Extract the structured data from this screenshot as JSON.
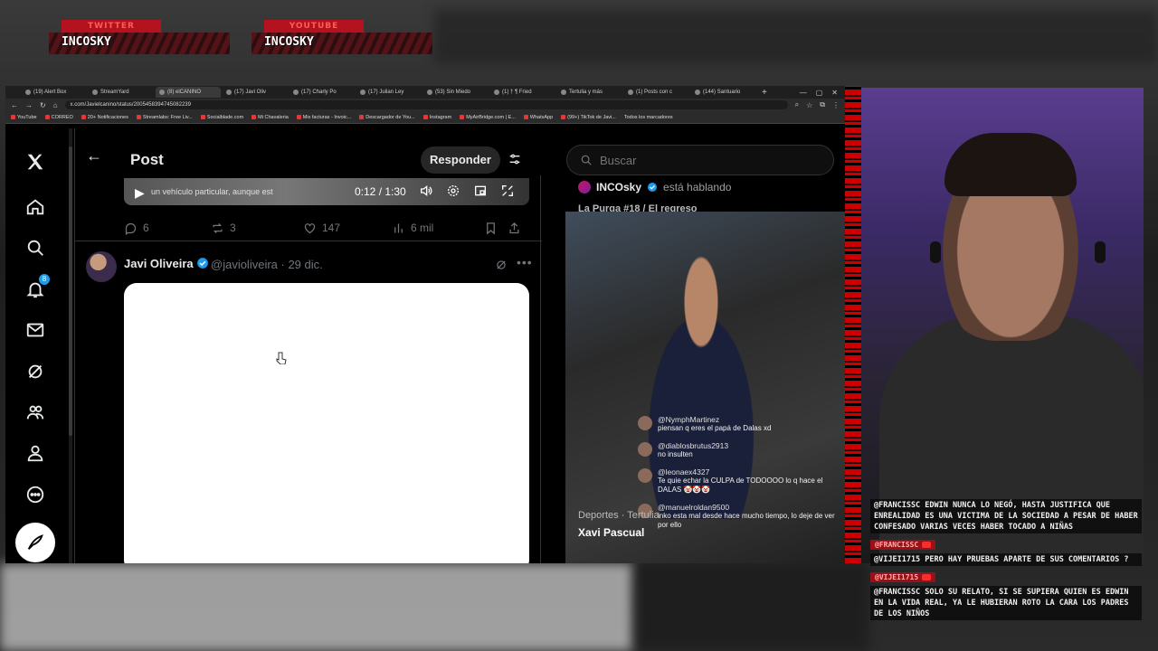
{
  "banners": [
    {
      "platform": "TWITTER",
      "name": "INCOSKY"
    },
    {
      "platform": "YOUTUBE",
      "name": "INCOSKY"
    }
  ],
  "browser": {
    "tabs": [
      "(19) Alert Box",
      "StreamYard",
      "(8) elCANINO",
      "(17) Javi Oliv",
      "(17) Charly Po",
      "(17) Julian Ley",
      "(53) Sin Miedo",
      "(1) † ¶ Fried",
      "Tertulia y más",
      "(1) Posts con c",
      "(144) Santuario"
    ],
    "url": "x.com/Javielcanino/status/2005458394745082239",
    "bookmarks": [
      "YouTube",
      "CORREO",
      "20+ Notificaciones",
      "Streamlabs: Free Liv...",
      "Socialblade.com",
      "Mi Chavaleria",
      "Mis facturas - Invoic...",
      "Descargador de You...",
      "Instagram",
      "MyAirBridge.com | E...",
      "WhatsApp",
      "(99+) TikTok de Javi...",
      "Todos los marcadores"
    ]
  },
  "x": {
    "notifications_count": "8",
    "header": {
      "title": "Post",
      "reply_button": "Responder"
    },
    "video": {
      "subtitle": "un vehículo particular, aunque est",
      "time": "0:12 / 1:30"
    },
    "actions": {
      "replies": "6",
      "reposts": "3",
      "likes": "147",
      "views": "6 mil"
    },
    "reply": {
      "author": "Javi Oliveira",
      "handle": "@javioliveira · 29 dic."
    },
    "right": {
      "search_placeholder": "Buscar",
      "live_name": "INCOsky",
      "live_status": "está hablando",
      "live_title": "La Purga #18 / El regreso"
    }
  },
  "stream_chat": [
    {
      "user": "@NymphMartinez",
      "text": "piensan q eres el papá de Dalas xd"
    },
    {
      "user": "@diablosbrutus2913",
      "text": "no insulten"
    },
    {
      "user": "@leonaex4327",
      "text": "Te quie echar la CULPA de TODOOOO lo q hace el DALAS 🤡🤡🤡"
    },
    {
      "user": "@manuelroldan9500",
      "text": "inko esta mal desde hace mucho tiempo, lo deje de ver por ello"
    }
  ],
  "stream_footer": {
    "category": "Deportes · Tertulia",
    "name": "Xavi Pascual"
  },
  "overlay_chat": [
    {
      "text": "@FRANCISSC EDWIN NUNCA LO NEGÓ, HASTA JUSTIFICA QUE ENREALIDAD ES UNA VICTIMA DE LA SOCIEDAD A PESAR DE HABER CONFESADO VARIAS VECES HABER TOCADO A NIÑAS",
      "user": "@FRANCISSC"
    },
    {
      "text": "@VIJEI1715 PERO HAY PRUEBAS APARTE DE SUS COMENTARIOS ?",
      "user": "@VIJEI1715"
    },
    {
      "text": "@FRANCISSC SOLO SU RELATO, SI SE SUPIERA QUIEN ES EDWIN EN LA VIDA REAL, YA LE HUBIERAN ROTO LA CARA LOS PADRES DE LOS NIÑOS",
      "user": ""
    }
  ],
  "colors": {
    "accent": "#1d9bf0",
    "stream_red": "#b3121e",
    "x_bg": "#000000"
  }
}
